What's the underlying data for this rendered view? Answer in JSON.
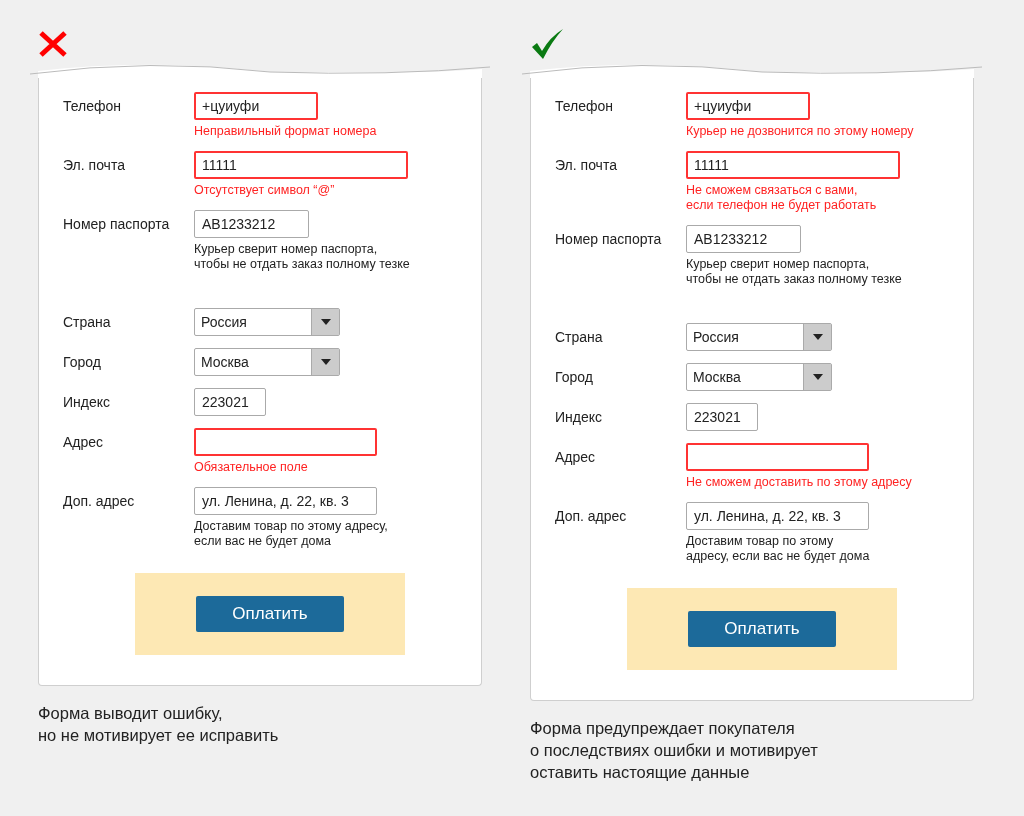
{
  "panels": [
    {
      "kind": "bad",
      "fields": [
        {
          "label": "Телефон",
          "kind": "text",
          "value": "+цуиуфи",
          "error": true,
          "message": {
            "kind": "error",
            "text": "Неправильный формат номера"
          }
        },
        {
          "label": "Эл. почта",
          "kind": "text",
          "value": "11111",
          "error": true,
          "message": {
            "kind": "error",
            "text": "Отсутствует символ “@”"
          }
        },
        {
          "label": "Номер паспорта",
          "kind": "text",
          "value": "AB1233212",
          "error": false,
          "message": {
            "kind": "hint",
            "text": "Курьер сверит номер паспорта,\nчтобы не отдать заказ полному тезке"
          }
        },
        {
          "label": "Страна",
          "kind": "select",
          "value": "Россия",
          "error": false
        },
        {
          "label": "Город",
          "kind": "select",
          "value": "Москва",
          "error": false
        },
        {
          "label": "Индекс",
          "kind": "text",
          "value": "223021",
          "error": false
        },
        {
          "label": "Адрес",
          "kind": "text",
          "error": true,
          "message": {
            "kind": "error",
            "text": "Обязательное поле"
          }
        },
        {
          "label": "Доп. адрес",
          "kind": "text",
          "value": "ул. Ленина, д. 22, кв. 3",
          "error": false,
          "message": {
            "kind": "hint",
            "text": "Доставим товар по этому адресу,\nесли вас не будет дома"
          }
        }
      ],
      "button": "Оплатить",
      "caption": "Форма выводит ошибку,\nно не мотивирует ее исправить"
    },
    {
      "kind": "good",
      "fields": [
        {
          "label": "Телефон",
          "kind": "text",
          "value": "+цуиуфи",
          "error": true,
          "message": {
            "kind": "error",
            "text": "Курьер не дозвонится по этому номеру"
          }
        },
        {
          "label": "Эл. почта",
          "kind": "text",
          "value": "11111",
          "error": true,
          "message": {
            "kind": "error",
            "text": "Не сможем связаться с вами,\nесли телефон не будет работать"
          }
        },
        {
          "label": "Номер паспорта",
          "kind": "text",
          "value": "AB1233212",
          "error": false,
          "message": {
            "kind": "hint",
            "text": "Курьер сверит номер паспорта,\nчтобы не отдать заказ полному тезке"
          }
        },
        {
          "label": "Страна",
          "kind": "select",
          "value": "Россия",
          "error": false
        },
        {
          "label": "Город",
          "kind": "select",
          "value": "Москва",
          "error": false
        },
        {
          "label": "Индекс",
          "kind": "text",
          "value": "223021",
          "error": false
        },
        {
          "label": "Адрес",
          "kind": "text",
          "error": true,
          "message": {
            "kind": "error",
            "text": "Не сможем доставить по этому адресу"
          }
        },
        {
          "label": "Доп. адрес",
          "kind": "text",
          "value": "ул. Ленина, д. 22, кв. 3",
          "error": false,
          "message": {
            "kind": "hint",
            "text": "Доставим товар по этому\nадресу, если вас не будет дома"
          }
        }
      ],
      "button": "Оплатить",
      "caption": "Форма предупреждает покупателя\nо последствиях ошибки и мотивирует\nоставить настоящие данные"
    }
  ]
}
